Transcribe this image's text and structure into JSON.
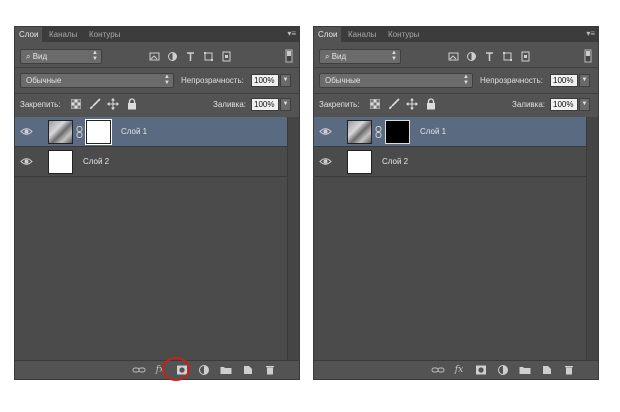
{
  "panels": [
    {
      "tabs": [
        "Слои",
        "Каналы",
        "Контуры"
      ],
      "filter_label": "Вид",
      "blend_mode": "Обычные",
      "opacity_label": "Непрозрачность:",
      "opacity_value": "100%",
      "lock_label": "Закрепить:",
      "fill_label": "Заливка:",
      "fill_value": "100%",
      "layers": [
        {
          "name": "Слой 1",
          "mask": "white",
          "selected": true
        },
        {
          "name": "Слой 2",
          "mask": "none",
          "selected": false
        }
      ],
      "footer_icons": [
        "link-icon",
        "fx-icon",
        "add-mask-icon",
        "adjustment-icon",
        "folder-icon",
        "new-layer-icon",
        "trash-icon"
      ],
      "fx_text": "fx",
      "mask_button_highlighted": true
    },
    {
      "tabs": [
        "Слои",
        "Каналы",
        "Контуры"
      ],
      "filter_label": "Вид",
      "blend_mode": "Обычные",
      "opacity_label": "Непрозрачность:",
      "opacity_value": "100%",
      "lock_label": "Закрепить:",
      "fill_label": "Заливка:",
      "fill_value": "100%",
      "layers": [
        {
          "name": "Слой 1",
          "mask": "black",
          "selected": true
        },
        {
          "name": "Слой 2",
          "mask": "none",
          "selected": false
        }
      ],
      "footer_icons": [
        "link-icon",
        "fx-icon",
        "add-mask-icon",
        "adjustment-icon",
        "folder-icon",
        "new-layer-icon",
        "trash-icon"
      ],
      "fx_text": "fx",
      "mask_button_highlighted": false
    }
  ],
  "colors": {
    "panel_bg": "#535353",
    "selected_layer": "#5a6a80",
    "highlight_circle": "#c8201a"
  }
}
